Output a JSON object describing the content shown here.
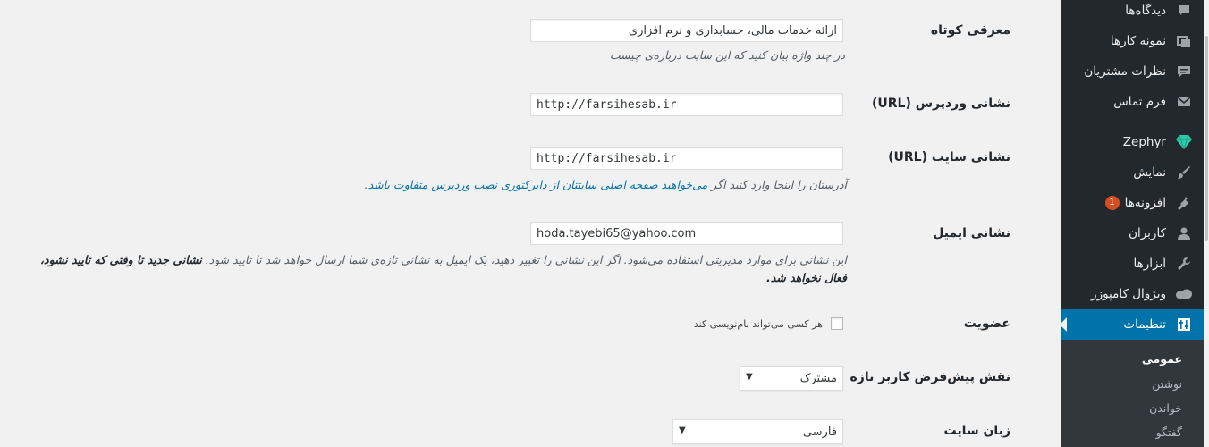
{
  "sidebar": {
    "items": [
      {
        "label": "دیدگاه‌ها",
        "icon": "comment-icon"
      },
      {
        "label": "نمونه کارها",
        "icon": "portfolio-icon"
      },
      {
        "label": "نظرات مشتریان",
        "icon": "testimonial-icon"
      },
      {
        "label": "فرم تماس",
        "icon": "mail-icon"
      },
      {
        "label": "Zephyr",
        "icon": "diamond-icon"
      },
      {
        "label": "نمایش",
        "icon": "paintbrush-icon"
      },
      {
        "label": "افزونه‌ها",
        "icon": "plugin-icon",
        "badge": "1"
      },
      {
        "label": "کاربران",
        "icon": "user-icon"
      },
      {
        "label": "ابزارها",
        "icon": "wrench-icon"
      },
      {
        "label": "ویژوال کامپوزر",
        "icon": "cloud-icon"
      },
      {
        "label": "تنظیمات",
        "icon": "settings-icon",
        "active": true
      }
    ],
    "submenu": [
      "عمومی",
      "نوشتن",
      "خواندن",
      "گفتگو"
    ]
  },
  "form": {
    "tagline": {
      "label": "معرفی کوتاه",
      "value": "ارائه خدمات مالی، حسابداری و نرم افزاری",
      "description": "در چند واژه بیان کنید که این سایت درباره‌ی چیست"
    },
    "wp_url": {
      "label": "نشانی وردپرس (URL)",
      "value": "http://farsihesab.ir"
    },
    "site_url": {
      "label": "نشانی سایت (URL)",
      "value": "http://farsihesab.ir",
      "desc_prefix": "آدرستان را اینجا وارد کنید اگر ",
      "desc_link": "می‌خواهید صفحه اصلی سایتتان از دایرکتوری نصب وردپرس متفاوت باشد",
      "desc_suffix": "."
    },
    "email": {
      "label": "نشانی ایمیل",
      "value": "hoda.tayebi65@yahoo.com",
      "desc_text": "این نشانی برای موارد مدیریتی استفاده می‌شود. اگر این نشانی را تغییر دهید، یک ایمیل به نشانی تازه‌ی شما ارسال خواهد شد تا تایید شود. ",
      "desc_bold": "نشانی جدید تا وقتی که تایید نشود، فعال نخواهد شد."
    },
    "membership": {
      "label": "عضویت",
      "checkbox_label": "هر کسی می‌تواند نام‌نویسی کند"
    },
    "default_role": {
      "label": "نقش پیش‌فرض کاربر تازه",
      "value": "مشترک"
    },
    "site_language": {
      "label": "زبان سایت",
      "value": "فارسی"
    }
  }
}
